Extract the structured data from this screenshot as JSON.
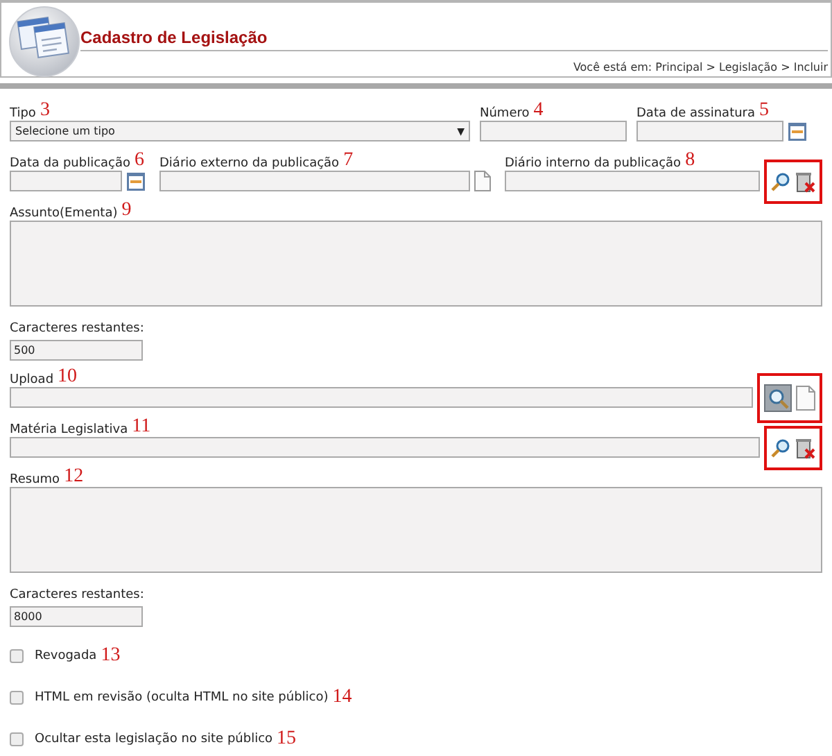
{
  "header": {
    "title": "Cadastro de Legislação",
    "breadcrumb": "Você está em: Principal > Legislação > Incluir"
  },
  "tipo": {
    "label": "Tipo",
    "note": "3",
    "value": "Selecione um tipo",
    "caret": "▼"
  },
  "numero": {
    "label": "Número",
    "note": "4"
  },
  "data_assinatura": {
    "label": "Data de assinatura",
    "note": "5"
  },
  "data_publicacao": {
    "label": "Data da publicação",
    "note": "6"
  },
  "diario_externo": {
    "label": "Diário externo da publicação",
    "note": "7"
  },
  "diario_interno": {
    "label": "Diário interno da publicação",
    "note": "8",
    "highlighted": true
  },
  "assunto": {
    "label": "Assunto(Ementa)",
    "note": "9"
  },
  "assunto_counter": {
    "label": "Caracteres restantes:",
    "value": "500"
  },
  "upload": {
    "label": "Upload",
    "note": "10",
    "highlighted": true
  },
  "materia": {
    "label": "Matéria Legislativa",
    "note": "11",
    "highlighted": true
  },
  "resumo": {
    "label": "Resumo",
    "note": "12"
  },
  "resumo_counter": {
    "label": "Caracteres restantes:",
    "value": "8000"
  },
  "options": [
    {
      "label": "Revogada",
      "note": "13",
      "checked": false
    },
    {
      "label": "HTML em revisão (oculta HTML no site público)",
      "note": "14",
      "checked": false
    },
    {
      "label": "Ocultar esta legislação no site público",
      "note": "15",
      "checked": false
    }
  ]
}
